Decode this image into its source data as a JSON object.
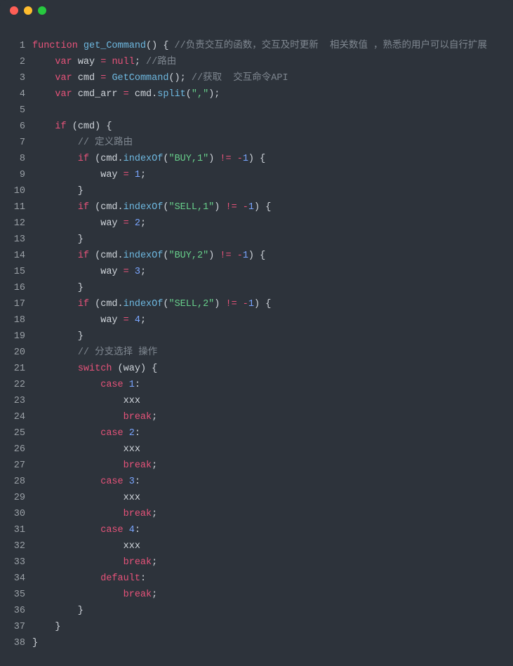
{
  "titlebar": {
    "dots": [
      "red",
      "yellow",
      "green"
    ]
  },
  "lines": [
    [
      {
        "t": "function ",
        "c": "kw"
      },
      {
        "t": "get_Command",
        "c": "fn"
      },
      {
        "t": "()",
        "c": "pun"
      },
      {
        "t": " {",
        "c": "pun"
      },
      {
        "t": " //负责交互的函数，交互及时更新  相关数值 ，熟悉的用户可以自行扩展",
        "c": "cmt"
      }
    ],
    [
      {
        "t": "    ",
        "c": "pun"
      },
      {
        "t": "var ",
        "c": "kw"
      },
      {
        "t": "way",
        "c": "id"
      },
      {
        "t": " = ",
        "c": "op"
      },
      {
        "t": "null",
        "c": "null"
      },
      {
        "t": ";",
        "c": "pun"
      },
      {
        "t": " //路由",
        "c": "cmt"
      }
    ],
    [
      {
        "t": "    ",
        "c": "pun"
      },
      {
        "t": "var ",
        "c": "kw"
      },
      {
        "t": "cmd",
        "c": "id"
      },
      {
        "t": " = ",
        "c": "op"
      },
      {
        "t": "GetCommand",
        "c": "fn"
      },
      {
        "t": "();",
        "c": "pun"
      },
      {
        "t": " //获取  交互命令API",
        "c": "cmt"
      }
    ],
    [
      {
        "t": "    ",
        "c": "pun"
      },
      {
        "t": "var ",
        "c": "kw"
      },
      {
        "t": "cmd_arr",
        "c": "id"
      },
      {
        "t": " = ",
        "c": "op"
      },
      {
        "t": "cmd",
        "c": "id"
      },
      {
        "t": ".",
        "c": "pun"
      },
      {
        "t": "split",
        "c": "fn"
      },
      {
        "t": "(",
        "c": "pun"
      },
      {
        "t": "\",\"",
        "c": "str"
      },
      {
        "t": ");",
        "c": "pun"
      }
    ],
    [],
    [
      {
        "t": "    ",
        "c": "pun"
      },
      {
        "t": "if",
        "c": "kw"
      },
      {
        "t": " (",
        "c": "pun"
      },
      {
        "t": "cmd",
        "c": "id"
      },
      {
        "t": ") {",
        "c": "pun"
      }
    ],
    [
      {
        "t": "        ",
        "c": "pun"
      },
      {
        "t": "// 定义路由",
        "c": "cmt"
      }
    ],
    [
      {
        "t": "        ",
        "c": "pun"
      },
      {
        "t": "if",
        "c": "kw"
      },
      {
        "t": " (",
        "c": "pun"
      },
      {
        "t": "cmd",
        "c": "id"
      },
      {
        "t": ".",
        "c": "pun"
      },
      {
        "t": "indexOf",
        "c": "fn"
      },
      {
        "t": "(",
        "c": "pun"
      },
      {
        "t": "\"BUY,1\"",
        "c": "str"
      },
      {
        "t": ") ",
        "c": "pun"
      },
      {
        "t": "!=",
        "c": "op"
      },
      {
        "t": " ",
        "c": "pun"
      },
      {
        "t": "-",
        "c": "op"
      },
      {
        "t": "1",
        "c": "num"
      },
      {
        "t": ") {",
        "c": "pun"
      }
    ],
    [
      {
        "t": "            ",
        "c": "pun"
      },
      {
        "t": "way",
        "c": "id"
      },
      {
        "t": " = ",
        "c": "op"
      },
      {
        "t": "1",
        "c": "num"
      },
      {
        "t": ";",
        "c": "pun"
      }
    ],
    [
      {
        "t": "        }",
        "c": "pun"
      }
    ],
    [
      {
        "t": "        ",
        "c": "pun"
      },
      {
        "t": "if",
        "c": "kw"
      },
      {
        "t": " (",
        "c": "pun"
      },
      {
        "t": "cmd",
        "c": "id"
      },
      {
        "t": ".",
        "c": "pun"
      },
      {
        "t": "indexOf",
        "c": "fn"
      },
      {
        "t": "(",
        "c": "pun"
      },
      {
        "t": "\"SELL,1\"",
        "c": "str"
      },
      {
        "t": ") ",
        "c": "pun"
      },
      {
        "t": "!=",
        "c": "op"
      },
      {
        "t": " ",
        "c": "pun"
      },
      {
        "t": "-",
        "c": "op"
      },
      {
        "t": "1",
        "c": "num"
      },
      {
        "t": ") {",
        "c": "pun"
      }
    ],
    [
      {
        "t": "            ",
        "c": "pun"
      },
      {
        "t": "way",
        "c": "id"
      },
      {
        "t": " = ",
        "c": "op"
      },
      {
        "t": "2",
        "c": "num"
      },
      {
        "t": ";",
        "c": "pun"
      }
    ],
    [
      {
        "t": "        }",
        "c": "pun"
      }
    ],
    [
      {
        "t": "        ",
        "c": "pun"
      },
      {
        "t": "if",
        "c": "kw"
      },
      {
        "t": " (",
        "c": "pun"
      },
      {
        "t": "cmd",
        "c": "id"
      },
      {
        "t": ".",
        "c": "pun"
      },
      {
        "t": "indexOf",
        "c": "fn"
      },
      {
        "t": "(",
        "c": "pun"
      },
      {
        "t": "\"BUY,2\"",
        "c": "str"
      },
      {
        "t": ") ",
        "c": "pun"
      },
      {
        "t": "!=",
        "c": "op"
      },
      {
        "t": " ",
        "c": "pun"
      },
      {
        "t": "-",
        "c": "op"
      },
      {
        "t": "1",
        "c": "num"
      },
      {
        "t": ") {",
        "c": "pun"
      }
    ],
    [
      {
        "t": "            ",
        "c": "pun"
      },
      {
        "t": "way",
        "c": "id"
      },
      {
        "t": " = ",
        "c": "op"
      },
      {
        "t": "3",
        "c": "num"
      },
      {
        "t": ";",
        "c": "pun"
      }
    ],
    [
      {
        "t": "        }",
        "c": "pun"
      }
    ],
    [
      {
        "t": "        ",
        "c": "pun"
      },
      {
        "t": "if",
        "c": "kw"
      },
      {
        "t": " (",
        "c": "pun"
      },
      {
        "t": "cmd",
        "c": "id"
      },
      {
        "t": ".",
        "c": "pun"
      },
      {
        "t": "indexOf",
        "c": "fn"
      },
      {
        "t": "(",
        "c": "pun"
      },
      {
        "t": "\"SELL,2\"",
        "c": "str"
      },
      {
        "t": ") ",
        "c": "pun"
      },
      {
        "t": "!=",
        "c": "op"
      },
      {
        "t": " ",
        "c": "pun"
      },
      {
        "t": "-",
        "c": "op"
      },
      {
        "t": "1",
        "c": "num"
      },
      {
        "t": ") {",
        "c": "pun"
      }
    ],
    [
      {
        "t": "            ",
        "c": "pun"
      },
      {
        "t": "way",
        "c": "id"
      },
      {
        "t": " = ",
        "c": "op"
      },
      {
        "t": "4",
        "c": "num"
      },
      {
        "t": ";",
        "c": "pun"
      }
    ],
    [
      {
        "t": "        }",
        "c": "pun"
      }
    ],
    [
      {
        "t": "        ",
        "c": "pun"
      },
      {
        "t": "// 分支选择 操作",
        "c": "cmt"
      }
    ],
    [
      {
        "t": "        ",
        "c": "pun"
      },
      {
        "t": "switch",
        "c": "kw"
      },
      {
        "t": " (",
        "c": "pun"
      },
      {
        "t": "way",
        "c": "id"
      },
      {
        "t": ") {",
        "c": "pun"
      }
    ],
    [
      {
        "t": "            ",
        "c": "pun"
      },
      {
        "t": "case",
        "c": "kw"
      },
      {
        "t": " ",
        "c": "pun"
      },
      {
        "t": "1",
        "c": "num"
      },
      {
        "t": ":",
        "c": "pun"
      }
    ],
    [
      {
        "t": "                ",
        "c": "pun"
      },
      {
        "t": "xxx",
        "c": "id"
      }
    ],
    [
      {
        "t": "                ",
        "c": "pun"
      },
      {
        "t": "break",
        "c": "kw"
      },
      {
        "t": ";",
        "c": "pun"
      }
    ],
    [
      {
        "t": "            ",
        "c": "pun"
      },
      {
        "t": "case",
        "c": "kw"
      },
      {
        "t": " ",
        "c": "pun"
      },
      {
        "t": "2",
        "c": "num"
      },
      {
        "t": ":",
        "c": "pun"
      }
    ],
    [
      {
        "t": "                ",
        "c": "pun"
      },
      {
        "t": "xxx",
        "c": "id"
      }
    ],
    [
      {
        "t": "                ",
        "c": "pun"
      },
      {
        "t": "break",
        "c": "kw"
      },
      {
        "t": ";",
        "c": "pun"
      }
    ],
    [
      {
        "t": "            ",
        "c": "pun"
      },
      {
        "t": "case",
        "c": "kw"
      },
      {
        "t": " ",
        "c": "pun"
      },
      {
        "t": "3",
        "c": "num"
      },
      {
        "t": ":",
        "c": "pun"
      }
    ],
    [
      {
        "t": "                ",
        "c": "pun"
      },
      {
        "t": "xxx",
        "c": "id"
      }
    ],
    [
      {
        "t": "                ",
        "c": "pun"
      },
      {
        "t": "break",
        "c": "kw"
      },
      {
        "t": ";",
        "c": "pun"
      }
    ],
    [
      {
        "t": "            ",
        "c": "pun"
      },
      {
        "t": "case",
        "c": "kw"
      },
      {
        "t": " ",
        "c": "pun"
      },
      {
        "t": "4",
        "c": "num"
      },
      {
        "t": ":",
        "c": "pun"
      }
    ],
    [
      {
        "t": "                ",
        "c": "pun"
      },
      {
        "t": "xxx",
        "c": "id"
      }
    ],
    [
      {
        "t": "                ",
        "c": "pun"
      },
      {
        "t": "break",
        "c": "kw"
      },
      {
        "t": ";",
        "c": "pun"
      }
    ],
    [
      {
        "t": "            ",
        "c": "pun"
      },
      {
        "t": "default",
        "c": "kw"
      },
      {
        "t": ":",
        "c": "pun"
      }
    ],
    [
      {
        "t": "                ",
        "c": "pun"
      },
      {
        "t": "break",
        "c": "kw"
      },
      {
        "t": ";",
        "c": "pun"
      }
    ],
    [
      {
        "t": "        }",
        "c": "pun"
      }
    ],
    [
      {
        "t": "    }",
        "c": "pun"
      }
    ],
    [
      {
        "t": "}",
        "c": "pun"
      }
    ]
  ]
}
